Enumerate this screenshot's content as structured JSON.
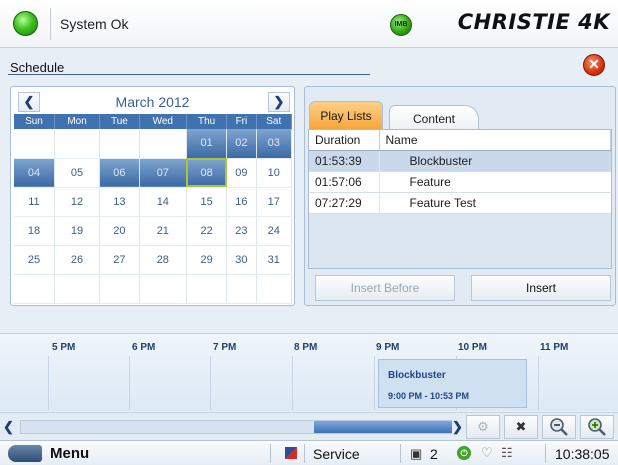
{
  "header": {
    "status_text": "System Ok",
    "imb_badge": "IMB",
    "brand": "CHRISTIE 4K"
  },
  "schedule": {
    "title": "Schedule",
    "close_icon": "close-icon"
  },
  "calendar": {
    "month_label": "March 2012",
    "weekdays": [
      "Sun",
      "Mon",
      "Tue",
      "Wed",
      "Thu",
      "Fri",
      "Sat"
    ],
    "weeks": [
      [
        "",
        "",
        "",
        "",
        "01",
        "02",
        "03"
      ],
      [
        "04",
        "05",
        "06",
        "07",
        "08",
        "09",
        "10"
      ],
      [
        "11",
        "12",
        "13",
        "14",
        "15",
        "16",
        "17"
      ],
      [
        "18",
        "19",
        "20",
        "21",
        "22",
        "23",
        "24"
      ],
      [
        "25",
        "26",
        "27",
        "28",
        "29",
        "30",
        "31"
      ],
      [
        "",
        "",
        "",
        "",
        "",
        "",
        ""
      ]
    ],
    "prev_icon": "chevron-left-icon",
    "next_icon": "chevron-right-icon"
  },
  "playlists": {
    "tabs": [
      {
        "label": "Play Lists",
        "active": true
      },
      {
        "label": "Content",
        "active": false
      }
    ],
    "columns": [
      "Duration",
      "Name"
    ],
    "rows": [
      {
        "duration": "01:53:39",
        "name": "Blockbuster",
        "selected": true
      },
      {
        "duration": "01:57:06",
        "name": "Feature",
        "selected": false
      },
      {
        "duration": "07:27:29",
        "name": "Feature Test",
        "selected": false
      }
    ],
    "insert_before_label": "Insert Before",
    "insert_label": "Insert"
  },
  "timeline": {
    "hours": [
      "5 PM",
      "6 PM",
      "7 PM",
      "8 PM",
      "9 PM",
      "10 PM",
      "11 PM"
    ],
    "event": {
      "title": "Blockbuster",
      "time": "9:00 PM - 10:53 PM"
    }
  },
  "toolbar": {
    "icons": [
      "gear-icon",
      "delete-icon",
      "zoom-out-icon",
      "zoom-in-icon"
    ]
  },
  "bottombar": {
    "menu_label": "Menu",
    "service_label": "Service",
    "projector_count": "2",
    "time": "10:38:05"
  }
}
